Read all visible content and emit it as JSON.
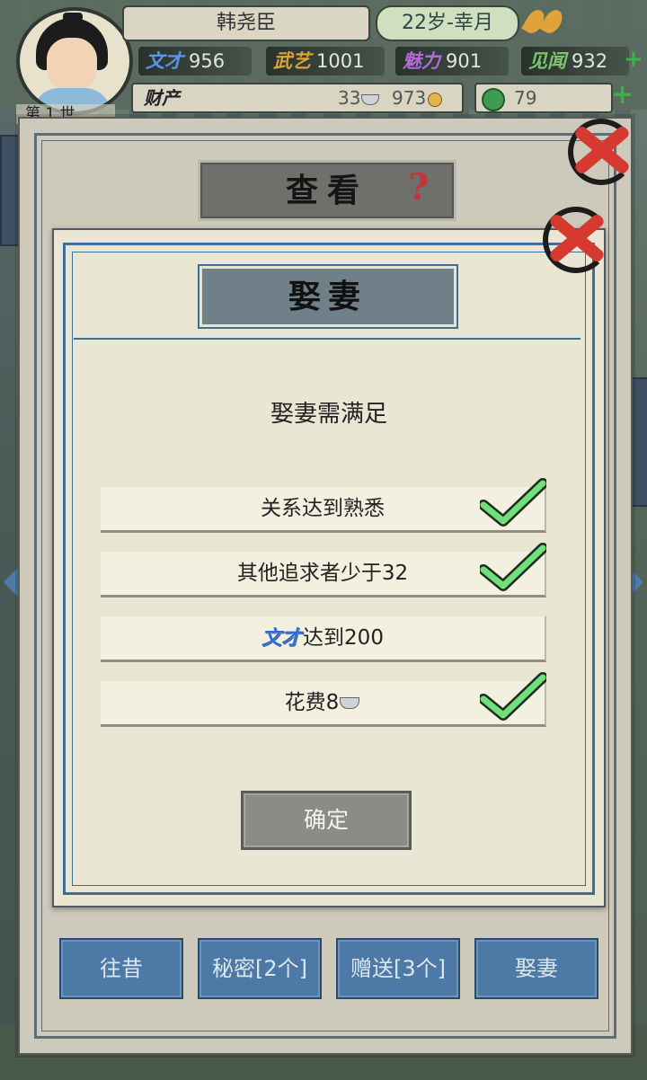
{
  "player": {
    "name": "韩尧臣",
    "age_label": "22岁-幸月",
    "generation_label": "第 1 世"
  },
  "stats": [
    {
      "key": "文才",
      "value": "956",
      "color": "#5b93e8"
    },
    {
      "key": "武艺",
      "value": "1001",
      "color": "#d9a43a"
    },
    {
      "key": "魅力",
      "value": "901",
      "color": "#b06bd8"
    },
    {
      "key": "见闻",
      "value": "932",
      "color": "#7bc46a"
    }
  ],
  "wealth": {
    "label": "财产",
    "silver": "33",
    "copper": "973",
    "jade": "79"
  },
  "outer_dialog": {
    "title": "查看",
    "help_icon": "?",
    "tabs": [
      {
        "label": "往昔"
      },
      {
        "label": "秘密[2个]"
      },
      {
        "label": "赠送[3个]"
      },
      {
        "label": "娶妻"
      }
    ]
  },
  "inner_dialog": {
    "title": "娶妻",
    "heading": "娶妻需满足",
    "conditions": [
      {
        "text": "关系达到熟悉",
        "met": true
      },
      {
        "text": "其他追求者少于32",
        "met": true
      },
      {
        "icon_text": "文才",
        "text": "达到200",
        "met": false
      },
      {
        "text": "花费8",
        "met": true
      }
    ],
    "confirm_label": "确定"
  },
  "colors": {
    "accent_blue": "#4c79a6",
    "check_green": "#6fe07a",
    "close_red": "#d6392f",
    "help_red": "#c0363a"
  }
}
